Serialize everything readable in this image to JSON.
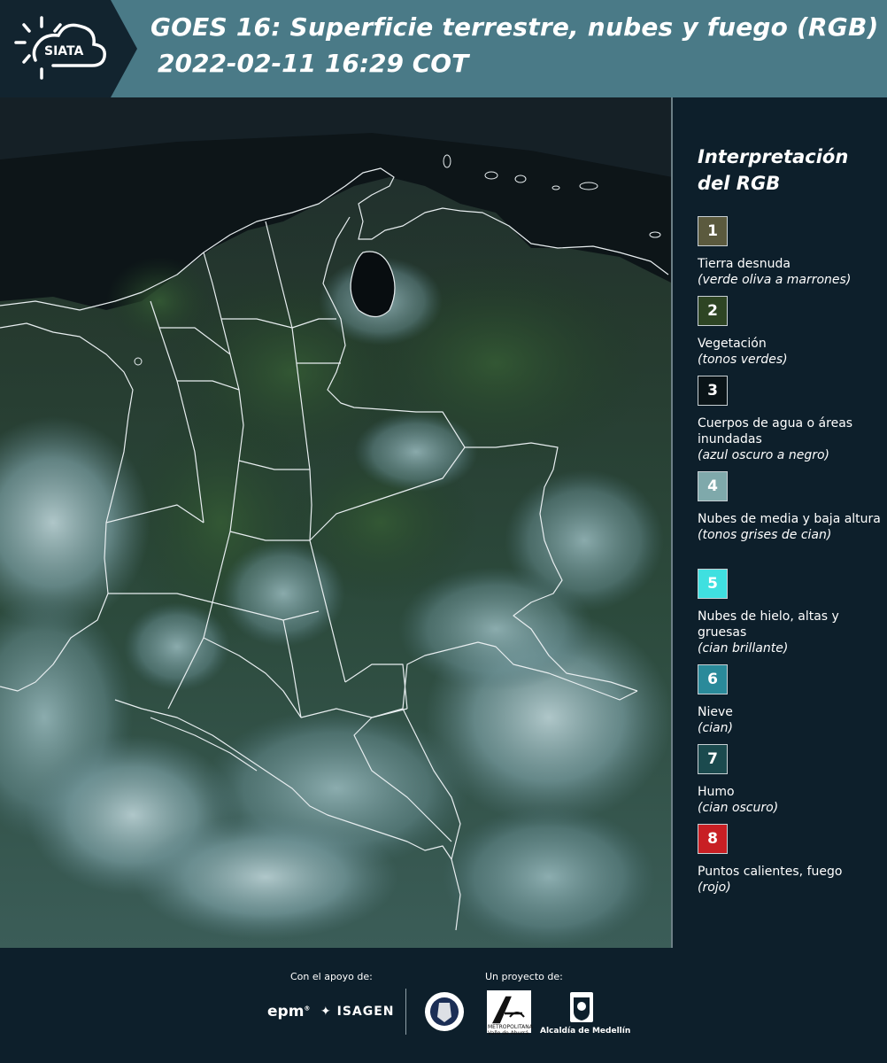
{
  "header": {
    "logo_text": "SIATA",
    "title_line1": "GOES 16: Superficie terrestre, nubes y fuego (RGB)",
    "title_line2": "2022-02-11 16:29 COT"
  },
  "legend": {
    "title": "Interpretación del RGB",
    "items": [
      {
        "number": "1",
        "label": "Tierra desnuda",
        "note": "(verde oliva a marrones)",
        "color": "#5b5a3e",
        "text_color": "#ffffff"
      },
      {
        "number": "2",
        "label": "Vegetación",
        "note": "(tonos verdes)",
        "color": "#2e4524",
        "text_color": "#ffffff"
      },
      {
        "number": "3",
        "label": "Cuerpos de agua o áreas inundadas",
        "note": "(azul oscuro a negro)",
        "color": "#0a1418",
        "text_color": "#ffffff"
      },
      {
        "number": "4",
        "label": "Nubes de media y baja altura",
        "note": "(tonos grises de cian)",
        "color": "#7fa9ab",
        "text_color": "#ffffff"
      },
      {
        "number": "5",
        "label": "Nubes de hielo, altas y gruesas",
        "note": "(cian brillante)",
        "color": "#3fe0e0",
        "text_color": "#ffffff"
      },
      {
        "number": "6",
        "label": "Nieve",
        "note": "(cian)",
        "color": "#2a8a9a",
        "text_color": "#ffffff"
      },
      {
        "number": "7",
        "label": "Humo",
        "note": "(cian oscuro)",
        "color": "#1b4a4e",
        "text_color": "#ffffff"
      },
      {
        "number": "8",
        "label": "Puntos calientes, fuego",
        "note": "(rojo)",
        "color": "#c81f24",
        "text_color": "#ffffff"
      }
    ]
  },
  "footer": {
    "support_label": "Con el apoyo de:",
    "project_label": "Un proyecto de:",
    "epm_logo": "epm",
    "isagen_logo": "ISAGEN",
    "amva_text": "METROPOLITANA Valle de Aburrá",
    "medellin_text": "Alcaldía de Medellín"
  },
  "colors": {
    "header_bg": "#4a7a87",
    "panel_bg": "#0d1f2b",
    "boundary": "#e8eef0"
  }
}
